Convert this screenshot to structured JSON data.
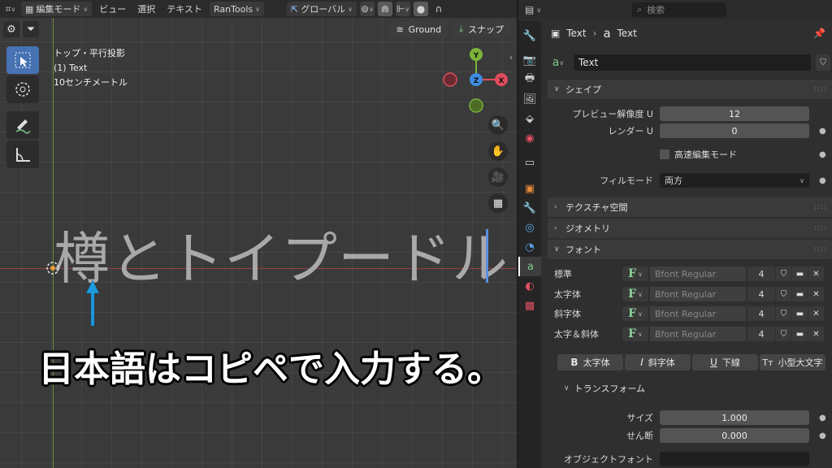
{
  "viewport": {
    "topbar": {
      "edit_mode": "編集モード",
      "menu_view": "ビュー",
      "menu_select": "選択",
      "menu_text": "テキスト",
      "addon": "RanTools",
      "transform_orientation": "グローバル"
    },
    "ground_label": "Ground",
    "snap_label": "スナップ",
    "info": {
      "view_name": "トップ・平行投影",
      "object": "(1) Text",
      "scale": "10センチメートル"
    },
    "gizmo": {
      "y": "Y",
      "z": "Z",
      "x": "X"
    },
    "text_object": "樽とトイプードル",
    "caption": "日本語はコピペで入力する。",
    "colors": {
      "accent": "#4772b3",
      "axis_x": "#e04c5c",
      "axis_y": "#7cb43a",
      "axis_z": "#3d8ce0"
    }
  },
  "properties": {
    "search_placeholder": "検索",
    "breadcrumb": {
      "object": "Text",
      "data": "Text"
    },
    "datablock_name": "Text",
    "shape": {
      "title": "シェイプ",
      "preview_u_label": "プレビュー解像度 U",
      "preview_u": "12",
      "render_u_label": "レンダー U",
      "render_u": "0",
      "fast_edit": "高速編集モード",
      "fill_mode_label": "フィルモード",
      "fill_mode": "両方"
    },
    "texture_space": "テクスチャ空間",
    "geometry": "ジオメトリ",
    "font": {
      "title": "フォント",
      "rows": [
        {
          "label": "標準",
          "name": "Bfont Regular",
          "users": "4"
        },
        {
          "label": "太字体",
          "name": "Bfont Regular",
          "users": "4"
        },
        {
          "label": "斜字体",
          "name": "Bfont Regular",
          "users": "4"
        },
        {
          "label": "太字＆斜体",
          "name": "Bfont Regular",
          "users": "4"
        }
      ],
      "style_bold": "太字体",
      "style_italic": "斜字体",
      "style_underline": "下線",
      "style_smallcaps": "小型大文字"
    },
    "transform": {
      "title": "トランスフォーム",
      "size_label": "サイズ",
      "size": "1.000",
      "shear_label": "せん断",
      "shear": "0.000",
      "object_font_label": "オブジェクトフォント"
    }
  }
}
